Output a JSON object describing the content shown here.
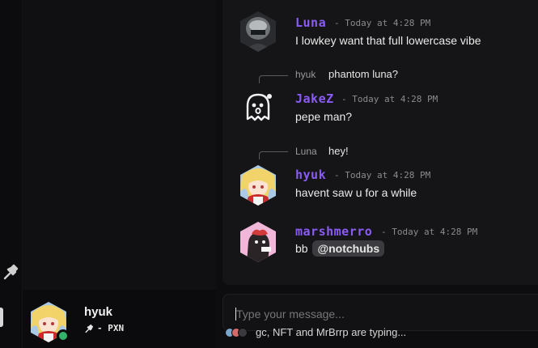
{
  "composer": {
    "placeholder": "Type your message...",
    "typing_text": "gc, NFT and MrBrrp are typing..."
  },
  "user_panel": {
    "username": "hyuk",
    "status_text": "- PXN",
    "status_color": "#33b26c"
  },
  "messages": [
    {
      "author": "Luna",
      "time": "- Today at 4:28 PM",
      "text": "I lowkey want that full lowercase vibe",
      "avatar_icon": "masked-figure-avatar"
    },
    {
      "author": "JakeZ",
      "time": "- Today at 4:28 PM",
      "text": "pepe man?",
      "avatar_icon": "ghost-face-avatar",
      "reply": {
        "author": "hyuk",
        "text": "phantom luna?"
      }
    },
    {
      "author": "hyuk",
      "time": "- Today at 4:28 PM",
      "text": "havent saw u for a while",
      "avatar_icon": "anime-girl-avatar",
      "reply": {
        "author": "Luna",
        "text": "hey!"
      }
    },
    {
      "author": "marshmerro",
      "time": "- Today at 4:28 PM",
      "text": "bb",
      "mention": "@notchubs",
      "avatar_icon": "pink-creature-avatar"
    }
  ],
  "colors": {
    "author": "#8a5cf5",
    "online": "#33b26c",
    "background": "#0d0d0f",
    "panel": "#151517"
  }
}
